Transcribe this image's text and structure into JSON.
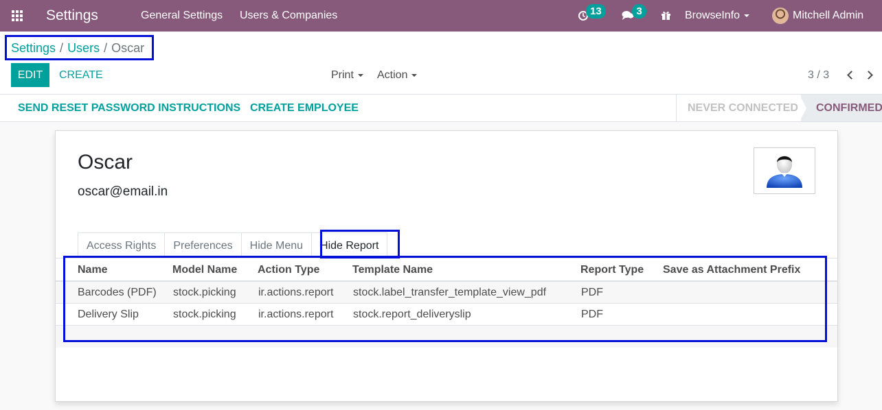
{
  "navbar": {
    "brand": "Settings",
    "menu": [
      "General Settings",
      "Users & Companies"
    ],
    "activity_count": "13",
    "message_count": "3",
    "company": "BrowseInfo",
    "user": "Mitchell Admin",
    "bg_color": "#875a7b"
  },
  "breadcrumb": {
    "root": "Settings",
    "parent": "Users",
    "current": "Oscar"
  },
  "toolbar": {
    "edit_label": "EDIT",
    "create_label": "CREATE",
    "print_label": "Print",
    "action_label": "Action",
    "pager": "3 / 3"
  },
  "statusbar": {
    "reset_password_label": "SEND RESET PASSWORD INSTRUCTIONS",
    "create_employee_label": "CREATE EMPLOYEE",
    "stages": [
      "NEVER CONNECTED",
      "CONFIRMED"
    ],
    "active_stage": "CONFIRMED"
  },
  "record": {
    "name": "Oscar",
    "email": "oscar@email.in"
  },
  "tabs": [
    {
      "label": "Access Rights"
    },
    {
      "label": "Preferences"
    },
    {
      "label": "Hide Menu"
    },
    {
      "label": "Hide Report"
    }
  ],
  "active_tab": "Hide Report",
  "table": {
    "columns": [
      "Name",
      "Model Name",
      "Action Type",
      "Template Name",
      "Report Type",
      "Save as Attachment Prefix"
    ],
    "rows": [
      [
        "Barcodes (PDF)",
        "stock.picking",
        "ir.actions.report",
        "stock.label_transfer_template_view_pdf",
        "PDF",
        ""
      ],
      [
        "Delivery Slip",
        "stock.picking",
        "ir.actions.report",
        "stock.report_deliveryslip",
        "PDF",
        ""
      ]
    ]
  },
  "accent_color": "#00a09d",
  "highlight_color": "#0010d8"
}
